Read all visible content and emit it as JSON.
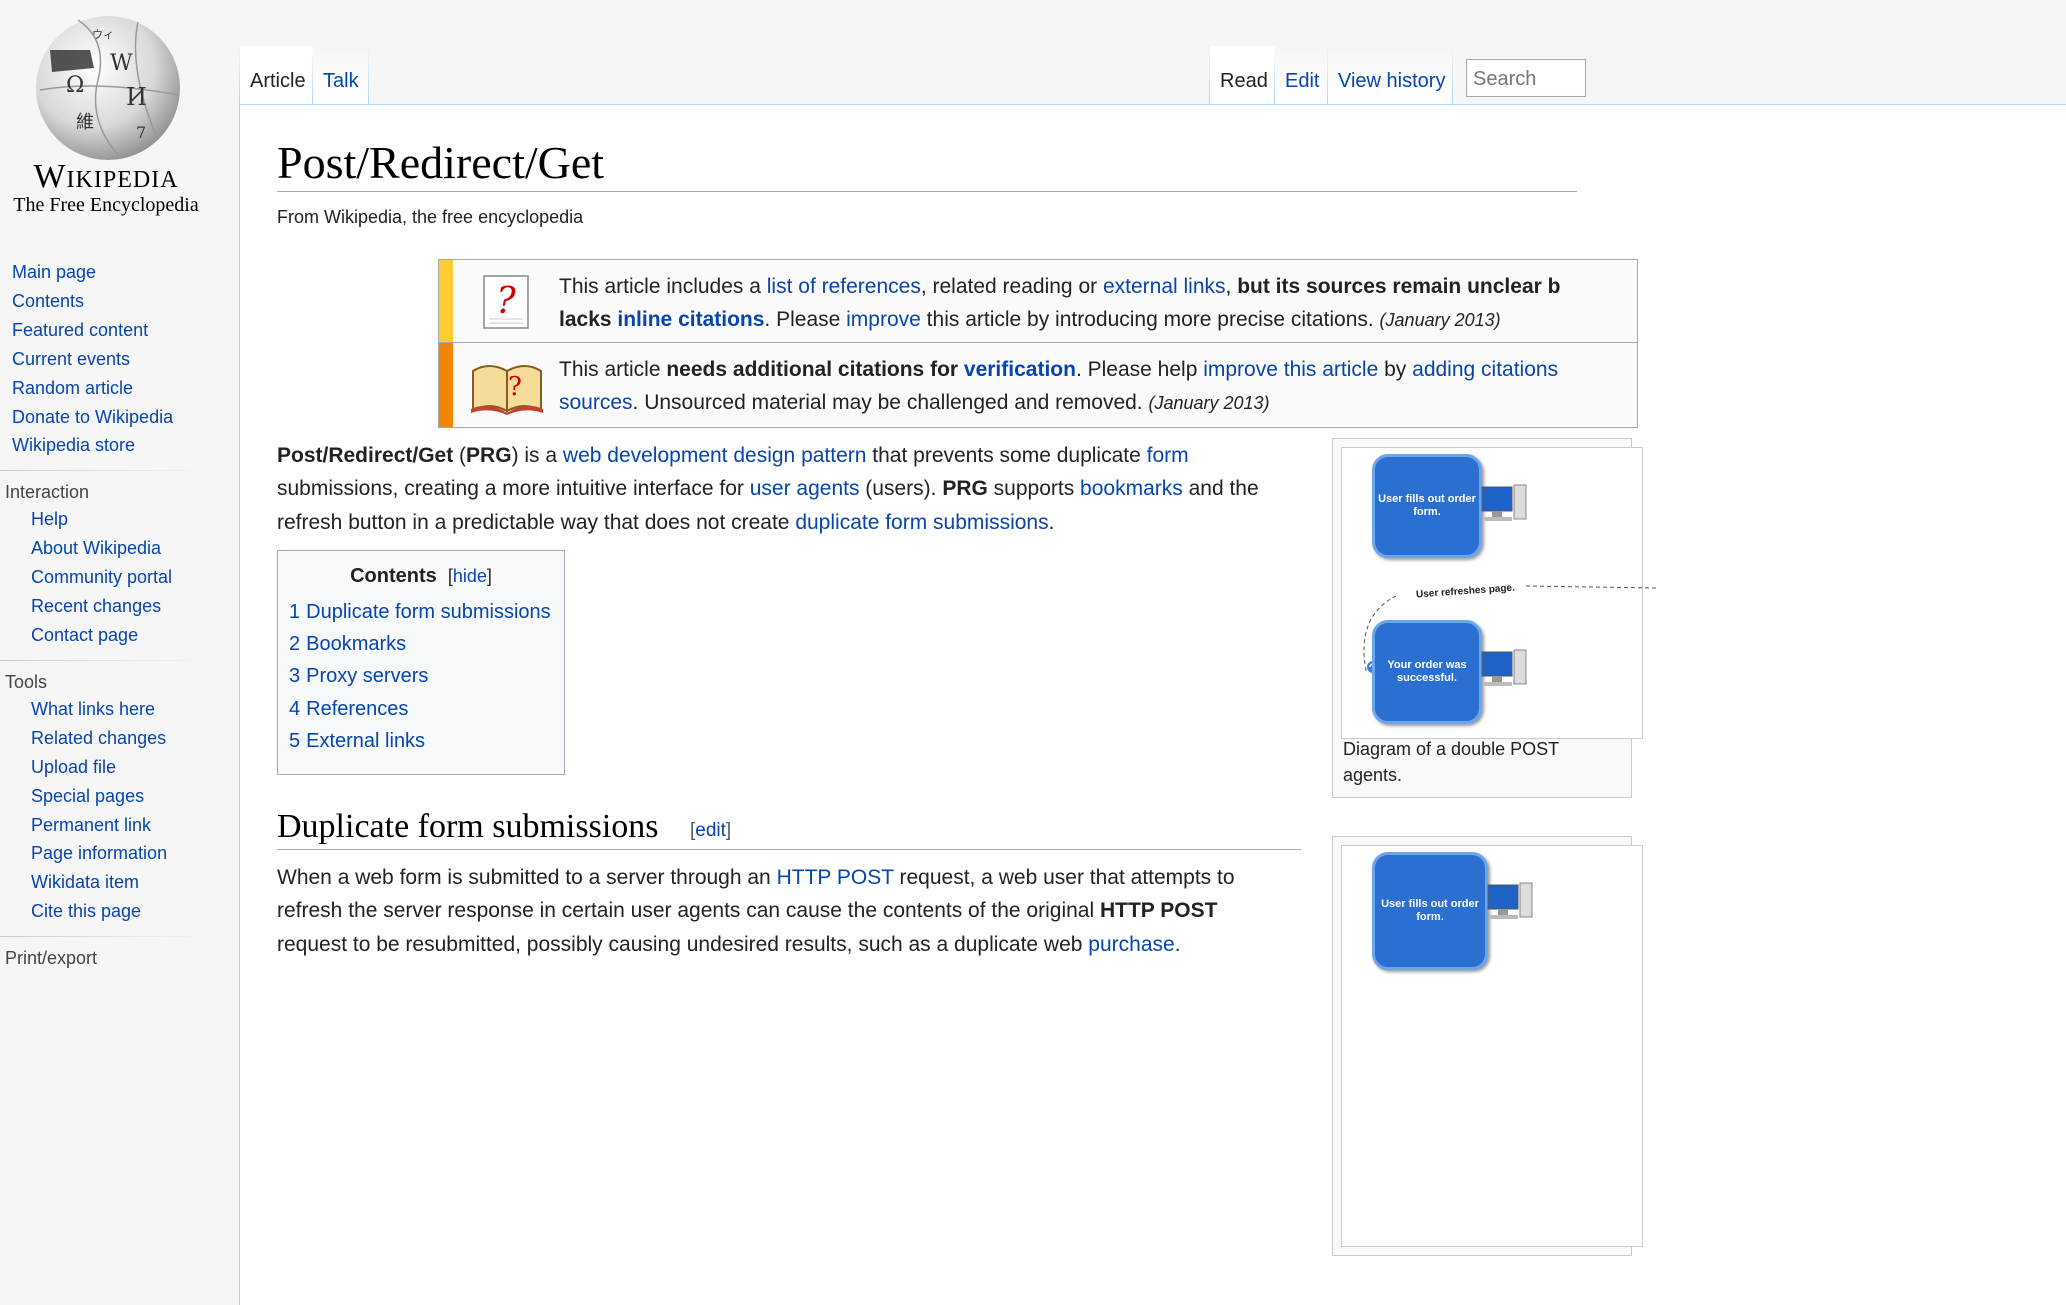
{
  "logo": {
    "wordmark": "Wikipedia",
    "tagline": "The Free Encyclopedia",
    "globe_glyphs": [
      "Ω",
      "W",
      "И",
      "維",
      "7",
      "ウィ"
    ]
  },
  "sidebar": {
    "main_links": [
      "Main page",
      "Contents",
      "Featured content",
      "Current events",
      "Random article",
      "Donate to Wikipedia",
      "Wikipedia store"
    ],
    "interaction": {
      "heading": "Interaction",
      "links": [
        "Help",
        "About Wikipedia",
        "Community portal",
        "Recent changes",
        "Contact page"
      ]
    },
    "tools": {
      "heading": "Tools",
      "links": [
        "What links here",
        "Related changes",
        "Upload file",
        "Special pages",
        "Permanent link",
        "Page information",
        "Wikidata item",
        "Cite this page"
      ]
    },
    "print": {
      "heading": "Print/export"
    }
  },
  "tabs": {
    "article": "Article",
    "talk": "Talk",
    "read": "Read",
    "edit": "Edit",
    "history": "View history",
    "search_placeholder": "Search"
  },
  "page": {
    "title": "Post/Redirect/Get",
    "subtitle": "From Wikipedia, the free encyclopedia"
  },
  "notices": {
    "refimprove": {
      "line1_a": "This article includes a ",
      "line1_link1": "list of references",
      "line1_b": ", related reading or ",
      "line1_link2": "external links",
      "line1_c": ", ",
      "line1_bold": "but its sources remain unclear b",
      "line2_bold": "lacks ",
      "line2_link_bold": "inline citations",
      "line2_a": ". Please ",
      "line2_link": "improve",
      "line2_b": " this article by introducing more precise citations. ",
      "line2_date": "(January 2013)"
    },
    "citations": {
      "line1_a": "This article ",
      "line1_bold": "needs additional citations for ",
      "line1_link_bold": "verification",
      "line1_b": ". Please help ",
      "line1_link1": "improve this article",
      "line1_c": " by ",
      "line1_link2": "adding citations",
      "line2_link": "sources",
      "line2_a": ". Unsourced material may be challenged and removed. ",
      "line2_date": "(January 2013)"
    }
  },
  "intro": {
    "l1_bold1": "Post/Redirect/Get",
    "l1_a": " (",
    "l1_bold2": "PRG",
    "l1_b": ") is a ",
    "l1_link1": "web development design pattern",
    "l1_c": " that prevents some duplicate ",
    "l1_link2": "form",
    "l2_a": "submissions, creating a more intuitive interface for ",
    "l2_link1": "user agents",
    "l2_b": " (users). ",
    "l2_bold": "PRG",
    "l2_c": " supports ",
    "l2_link2": "bookmarks",
    "l2_d": " and the",
    "l3_a": "refresh button in a predictable way that does not create ",
    "l3_link": "duplicate form submissions",
    "l3_b": "."
  },
  "toc": {
    "title": "Contents",
    "hide": "hide",
    "items": [
      {
        "num": "1",
        "label": "Duplicate form submissions"
      },
      {
        "num": "2",
        "label": "Bookmarks"
      },
      {
        "num": "3",
        "label": "Proxy servers"
      },
      {
        "num": "4",
        "label": "References"
      },
      {
        "num": "5",
        "label": "External links"
      }
    ]
  },
  "section1": {
    "heading": "Duplicate form submissions",
    "edit": "edit",
    "l1_a": "When a web form is submitted to a server through an ",
    "l1_link": "HTTP POST",
    "l1_b": " request, a web user that attempts to",
    "l2_a": "refresh the server response in certain user agents can cause the contents of the original ",
    "l2_bold": "HTTP POST",
    "l3_a": "request to be resubmitted, possibly causing undesired results, such as a duplicate web ",
    "l3_link": "purchase",
    "l3_b": "."
  },
  "figure1": {
    "box1": "User fills out order form.",
    "refresh_label": "User refreshes page.",
    "box2": "Your order was successful.",
    "caption_l1": "Diagram of a double POST",
    "caption_l2": "agents."
  },
  "figure2": {
    "box1": "User fills out order form."
  },
  "colors": {
    "link": "#0645ad",
    "ambox_content_bar": "#f28500",
    "ambox_style_bar": "#fc3",
    "tab_border": "#a7d7f9"
  }
}
